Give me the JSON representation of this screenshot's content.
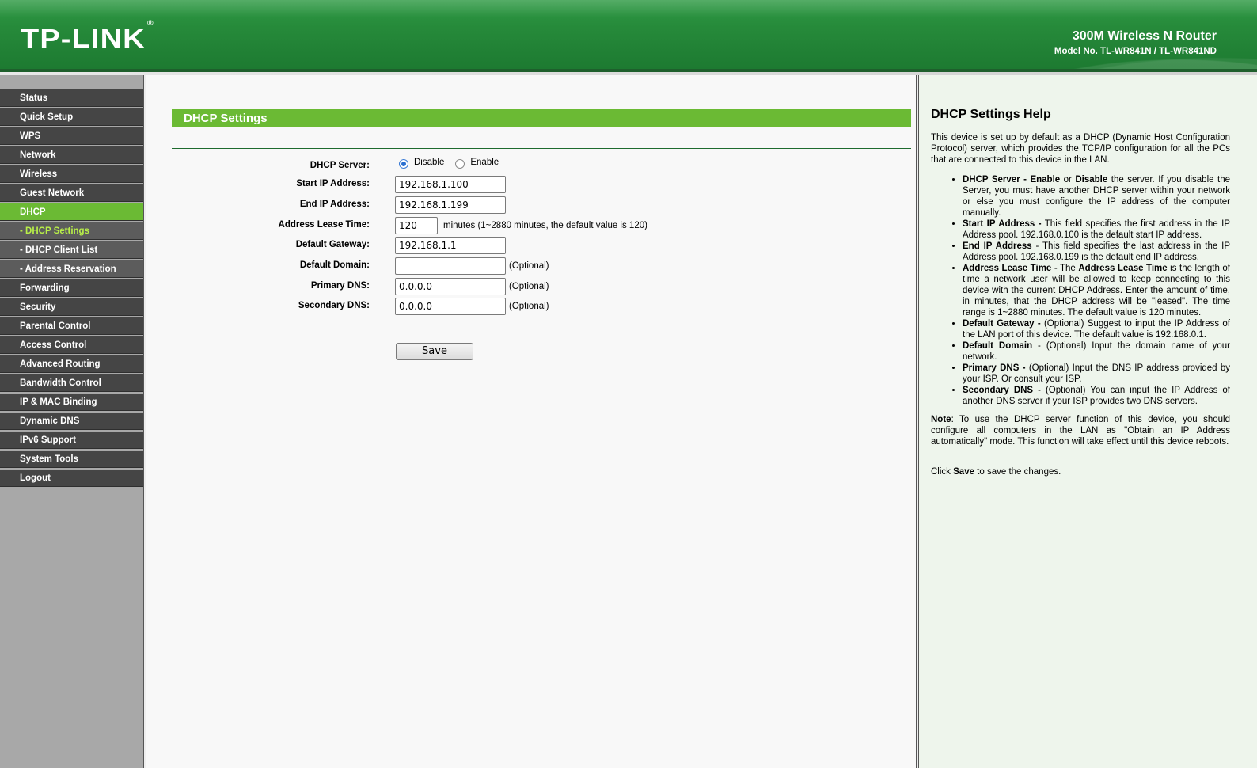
{
  "header": {
    "logo": "TP-LINK",
    "logo_mark": "®",
    "product_title": "300M Wireless N Router",
    "model_no": "Model No. TL-WR841N / TL-WR841ND"
  },
  "menu": [
    {
      "label": "Status"
    },
    {
      "label": "Quick Setup"
    },
    {
      "label": "WPS"
    },
    {
      "label": "Network"
    },
    {
      "label": "Wireless"
    },
    {
      "label": "Guest Network"
    },
    {
      "label": "DHCP"
    },
    {
      "label": "- DHCP Settings"
    },
    {
      "label": "- DHCP Client List"
    },
    {
      "label": "- Address Reservation"
    },
    {
      "label": "Forwarding"
    },
    {
      "label": "Security"
    },
    {
      "label": "Parental Control"
    },
    {
      "label": "Access Control"
    },
    {
      "label": "Advanced Routing"
    },
    {
      "label": "Bandwidth Control"
    },
    {
      "label": "IP & MAC Binding"
    },
    {
      "label": "Dynamic DNS"
    },
    {
      "label": "IPv6 Support"
    },
    {
      "label": "System Tools"
    },
    {
      "label": "Logout"
    }
  ],
  "main": {
    "section_title": "DHCP Settings",
    "dhcp_server": {
      "label": "DHCP Server:",
      "option_disable": "Disable",
      "option_enable": "Enable",
      "selected": "Disable"
    },
    "start_ip": {
      "label": "Start IP Address:",
      "value": "192.168.1.100"
    },
    "end_ip": {
      "label": "End IP Address:",
      "value": "192.168.1.199"
    },
    "lease_time": {
      "label": "Address Lease Time:",
      "value": "120",
      "hint": "minutes (1~2880 minutes, the default value is 120)"
    },
    "gateway": {
      "label": "Default Gateway:",
      "value": "192.168.1.1"
    },
    "domain": {
      "label": "Default Domain:",
      "value": "",
      "hint": "(Optional)"
    },
    "primary_dns": {
      "label": "Primary DNS:",
      "value": "0.0.0.0",
      "hint": "(Optional)"
    },
    "secondary_dns": {
      "label": "Secondary DNS:",
      "value": "0.0.0.0",
      "hint": "(Optional)"
    },
    "save_label": "Save"
  },
  "help": {
    "title": "DHCP Settings Help",
    "intro": "This device is set up by default as a DHCP (Dynamic Host Configuration Protocol) server, which provides the TCP/IP configuration for all the PCs that are connected to this device in the LAN.",
    "items": [
      {
        "term": "DHCP Server - Enable",
        "mid": " or ",
        "term2": "Disable",
        "text": " the server. If you disable the Server, you must have another DHCP server within your network or else you must configure the IP address of the computer manually."
      },
      {
        "term": "Start IP Address -",
        "text": " This field specifies the first address in the IP Address pool. 192.168.0.100 is the default start IP address."
      },
      {
        "term": "End IP Address",
        "text": " - This field specifies the last address in the IP Address pool. 192.168.0.199 is the default end IP address."
      },
      {
        "term": "Address Lease Time",
        "mid": " - The ",
        "term2": "Address Lease Time",
        "text": " is the length of time a network user will be allowed to keep connecting to this device with the current DHCP Address. Enter the amount of time, in minutes, that the DHCP address will be \"leased\". The time range is 1~2880 minutes. The default value is 120 minutes."
      },
      {
        "term": "Default Gateway -",
        "text": " (Optional) Suggest to input the IP Address of the LAN port of this device. The default value is 192.168.0.1."
      },
      {
        "term": "Default Domain",
        "text": " - (Optional) Input the domain name of your network."
      },
      {
        "term": "Primary DNS -",
        "text": " (Optional) Input the DNS IP address provided by your ISP. Or consult your ISP."
      },
      {
        "term": "Secondary DNS",
        "text": " - (Optional) You can input the IP Address of another DNS server if your ISP provides two DNS servers."
      }
    ],
    "note_label": "Note",
    "note_text": ": To use the DHCP server function of this device, you should configure all computers in the LAN as \"Obtain an IP Address automatically\" mode. This function will take effect until this device reboots.",
    "click_pre": "Click ",
    "click_save": "Save",
    "click_post": " to save the changes."
  }
}
